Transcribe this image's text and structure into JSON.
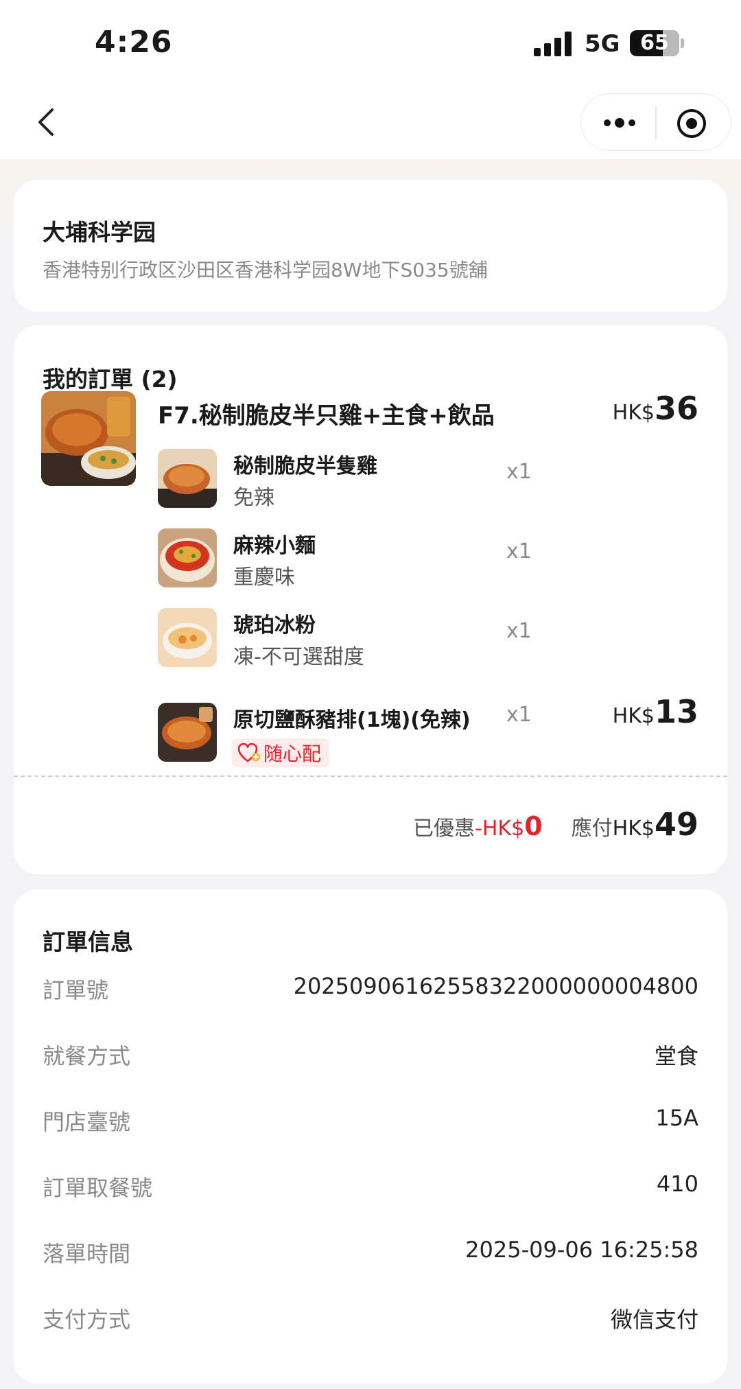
{
  "status_bar": {
    "time": "4:26",
    "network": "5G",
    "battery": "65"
  },
  "nav": {
    "back_icon": "chevron-left-icon",
    "more_icon": "more-dots-icon",
    "close_icon": "target-close-icon"
  },
  "store": {
    "name": "大埔科学园",
    "address": "香港特别行政区沙田区香港科学园8W地下S035號舖"
  },
  "order": {
    "title": "我的訂單 (2)",
    "combo": {
      "name": "F7.秘制脆皮半只雞+主食+飲品",
      "currency": "HK$",
      "price": "36",
      "items": [
        {
          "name": "秘制脆皮半隻雞",
          "spec": "免辣",
          "qty": "x1"
        },
        {
          "name": "麻辣小麵",
          "spec": "重慶味",
          "qty": "x1"
        },
        {
          "name": "琥珀冰粉",
          "spec": "凍-不可選甜度",
          "qty": "x1"
        }
      ]
    },
    "addon": {
      "name": "原切鹽酥豬排(1塊)(免辣)",
      "qty": "x1",
      "currency": "HK$",
      "price": "13",
      "tag": "随心配"
    },
    "summary": {
      "discount_label": "已優惠",
      "discount_prefix": "-HK$",
      "discount_amount": "0",
      "payable_label": "應付",
      "payable_currency": "HK$",
      "payable_amount": "49"
    }
  },
  "info": {
    "title": "訂單信息",
    "rows": [
      {
        "key": "訂單號",
        "value": "20250906162558322000000004800"
      },
      {
        "key": "就餐方式",
        "value": "堂食"
      },
      {
        "key": "門店臺號",
        "value": "15A"
      },
      {
        "key": "訂單取餐號",
        "value": "410"
      },
      {
        "key": "落單時間",
        "value": "2025-09-06 16:25:58"
      },
      {
        "key": "支付方式",
        "value": "微信支付"
      }
    ]
  },
  "colors": {
    "accent_red": "#e0232f",
    "page_bg": "#f3f3f5",
    "card_bg": "#ffffff"
  }
}
